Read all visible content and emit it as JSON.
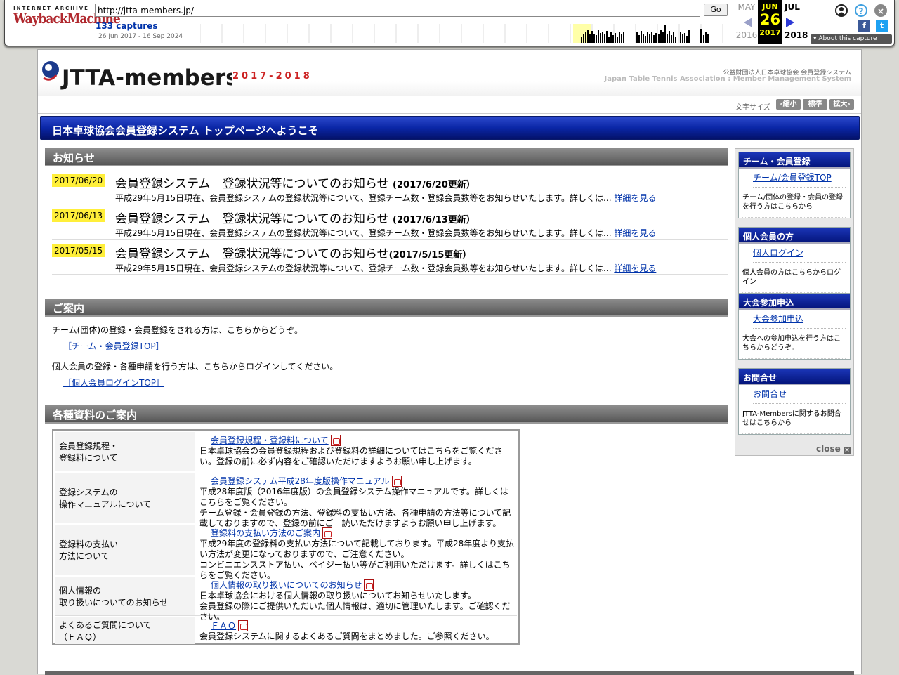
{
  "wayback": {
    "brand_top": "INTERNET ARCHIVE",
    "brand_main": "WaybackMachine",
    "url": "http://jtta-members.jp/",
    "go": "Go",
    "captures": "133 captures",
    "range": "26 Jun 2017 - 16 Sep 2024",
    "prev_month": "MAY",
    "prev_year": "2016",
    "cur_month": "JUN",
    "cur_day": "26",
    "cur_year": "2017",
    "next_month": "JUL",
    "next_year": "2018",
    "about": "About this capture",
    "colors": {
      "brand": "#b0282e",
      "current": "#ffff00"
    }
  },
  "header": {
    "logo_text": "JTTA-members.jp",
    "season": "2017-2018",
    "org_jp": "公益財団法人日本卓球協会 会員登録システム",
    "org_en": "Japan Table Tennis Association : Member Management System"
  },
  "fontsize": {
    "label": "文字サイズ",
    "small": "縮小",
    "normal": "標準",
    "large": "拡大"
  },
  "banner": "日本卓球協会会員登録システム トップページへようこそ",
  "news": {
    "heading": "お知らせ",
    "more": "詳細を見る",
    "items": [
      {
        "date": "2017/06/20",
        "title": "会員登録システム　登録状況等についてのお知らせ",
        "title_date": "(2017/6/20更新）",
        "desc": "平成29年5月15日現在、会員登録システムの登録状況等について、登録チーム数・登録会員数等をお知らせいたします。詳しくは..."
      },
      {
        "date": "2017/06/13",
        "title": "会員登録システム　登録状況等についてのお知らせ",
        "title_date": "(2017/6/13更新）",
        "desc": "平成29年5月15日現在、会員登録システムの登録状況等について、登録チーム数・登録会員数等をお知らせいたします。詳しくは..."
      },
      {
        "date": "2017/05/15",
        "title": "会員登録システム　登録状況等についてのお知らせ",
        "title_date": "(2017/5/15更新）",
        "desc": "平成29年5月15日現在、会員登録システムの登録状況等について、登録チーム数・登録会員数等をお知らせいたします。詳しくは..."
      }
    ]
  },
  "announce": {
    "heading": "ご案内",
    "p1": "チーム(団体)の登録・会員登録をされる方は、こちらからどうぞ。",
    "l1": "［チーム・会員登録TOP］",
    "p2": "個人会員の登録・各種申請を行う方は、こちらからログインしてください。",
    "l2": "［個人会員ログインTOP］"
  },
  "docs": {
    "heading": "各種資料のご案内",
    "rows": [
      {
        "k1": "会員登録規程・",
        "k2": "登録料について",
        "link": "会員登録規程・登録料について",
        "text": "日本卓球協会の会員登録規程および登録料の詳細についてはこちらをご覧ください。登録の前に必ず内容をご確認いただけますようお願い申し上げます。"
      },
      {
        "k1": "登録システムの",
        "k2": "操作マニュアルについて",
        "link": "会員登録システム平成28年度版操作マニュアル",
        "text": "平成28年度版（2016年度版）の会員登録システム操作マニュアルです。詳しくはこちらをご覧ください。",
        "text2": "チーム登録・会員登録の方法、登録料の支払い方法、各種申請の方法等について記載しておりますので、登録の前にご一読いただけますようお願い申し上げます。"
      },
      {
        "k1": "登録料の支払い",
        "k2": "方法について",
        "link": "登録料の支払い方法のご案内",
        "text": "平成29年度の登録料の支払い方法について記載しております。平成28年度より支払い方法が変更になっておりますので、ご注意ください。",
        "text2": "コンビニエンスストア払い、ペイジー払い等がご利用いただけます。詳しくはこちらをご覧ください。"
      },
      {
        "k1": "個人情報の",
        "k2": "取り扱いについてのお知らせ",
        "link": "個人情報の取り扱いについてのお知らせ",
        "text": "日本卓球協会における個人情報の取り扱いについてお知らせいたします。",
        "text2": "会員登録の際にご提供いただいた個人情報は、適切に管理いたします。ご確認ください。"
      },
      {
        "k1": "よくあるご質問について",
        "k2": "（ＦＡＱ）",
        "link": "ＦＡＱ",
        "text": "会員登録システムに関するよくあるご質問をまとめました。ご参照ください。"
      }
    ]
  },
  "sidebar": {
    "close": "close",
    "boxes": [
      {
        "head": "チーム・会員登録",
        "link": "チーム/会員登録TOP",
        "desc": "チーム/団体の登録・会員の登録を行う方はこちらから"
      },
      {
        "head": "個人会員の方",
        "link": "個人ログイン",
        "desc": "個人会員の方はこちらからログイン"
      },
      {
        "head": "大会参加申込",
        "link": "大会参加申込",
        "desc": "大会への参加申込を行う方はこちらからどうぞ。"
      },
      {
        "head": "お問合せ",
        "link": "お問合せ",
        "desc": "JTTA-Membersに関するお問合せはこちらから"
      }
    ]
  }
}
